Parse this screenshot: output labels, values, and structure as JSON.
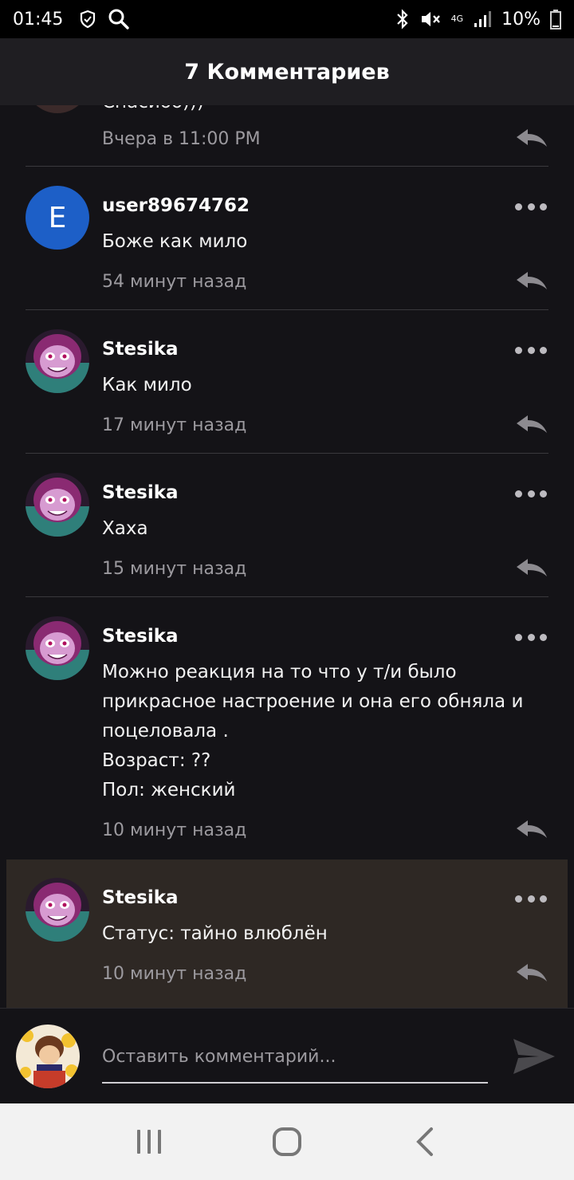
{
  "status_bar": {
    "time": "01:45",
    "network": "4G",
    "battery": "10%",
    "icons": [
      "shield-icon",
      "search-icon",
      "bluetooth-icon",
      "mute-icon",
      "signal-icon",
      "battery-icon"
    ]
  },
  "header": {
    "title": "7 Комментариев"
  },
  "partial_comment": {
    "text": "Спасибо)))",
    "time": "Вчера в 11:00 PM"
  },
  "comments": [
    {
      "username": "user89674762",
      "avatar_letter": "E",
      "text": "Боже как мило",
      "time": "54 минут назад"
    },
    {
      "username": "Stesika",
      "text": "Как мило",
      "time": "17 минут назад"
    },
    {
      "username": "Stesika",
      "text": "Хаха",
      "time": "15 минут назад"
    },
    {
      "username": "Stesika",
      "text": "Можно реакция на то что у т/и было прикрасное настроение и она его обняла и поцеловала .\nВозраст: ??\nПол: женский",
      "time": "10 минут назад"
    },
    {
      "username": "Stesika",
      "text": "Статус: тайно влюблён",
      "time": "10 минут назад",
      "highlighted": true
    }
  ],
  "composer": {
    "placeholder": "Оставить комментарий..."
  },
  "nav_bar": {
    "icons": [
      "recent-apps-icon",
      "home-icon",
      "back-icon"
    ]
  },
  "colors": {
    "background": "#141317",
    "header": "#1f1e22",
    "highlight": "#2e2824",
    "avatar_blue": "#1d5fc7",
    "muted_text": "#9c9a9f"
  }
}
